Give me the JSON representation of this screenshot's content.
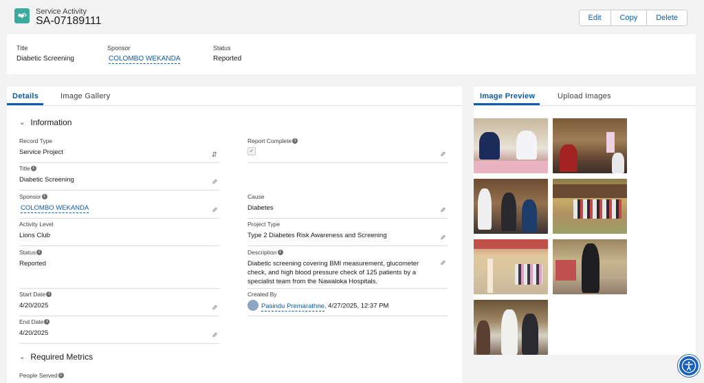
{
  "header": {
    "object_label": "Service Activity",
    "record_name": "SA-07189111",
    "buttons": {
      "edit": "Edit",
      "copy": "Copy",
      "delete": "Delete"
    },
    "highlights": {
      "title_label": "Title",
      "title_value": "Diabetic Screening",
      "sponsor_label": "Sponsor",
      "sponsor_value": "COLOMBO WEKANDA",
      "status_label": "Status",
      "status_value": "Reported"
    }
  },
  "main": {
    "tabs": {
      "details": "Details",
      "gallery": "Image Gallery"
    },
    "sections": {
      "information": "Information",
      "metrics": "Required Metrics"
    },
    "fields": {
      "record_type_label": "Record Type",
      "record_type": "Service Project",
      "report_complete_label": "Report Complete",
      "report_complete": true,
      "title_label": "Title",
      "title": "Diabetic Screening",
      "sponsor_label": "Sponsor",
      "sponsor": "COLOMBO WEKANDA",
      "cause_label": "Cause",
      "cause": "Diabetes",
      "activity_level_label": "Activity Level",
      "activity_level": "Lions Club",
      "project_type_label": "Project Type",
      "project_type": "Type 2 Diabetes Risk Awareness and Screening",
      "status_label": "Status",
      "status": "Reported",
      "description_label": "Description",
      "description": "Diabetic screening covering BMI measurement, glucometer check, and high blood pressure check of 125 patients by a specialist team from the Nawaloka Hospitals.",
      "start_date_label": "Start Date",
      "start_date": "4/20/2025",
      "created_by_label": "Created By",
      "created_by_name": "Pasindu Premarathne",
      "created_by_date": ", 4/27/2025, 12:37 PM",
      "end_date_label": "End Date",
      "end_date": "4/20/2025",
      "people_served_label": "People Served"
    }
  },
  "side": {
    "tabs": {
      "preview": "Image Preview",
      "upload": "Upload Images"
    },
    "image_count": 7
  },
  "colors": {
    "brand": "#0b5cab",
    "object_icon": "#3ba99c",
    "accessibility": "#1b5fbc"
  }
}
